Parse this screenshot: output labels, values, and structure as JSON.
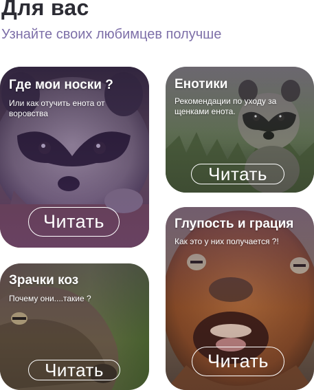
{
  "header": {
    "title": "Для вас",
    "subtitle": "Узнайте своих любимцев получше"
  },
  "cards": [
    {
      "id": "socks",
      "title": "Где мои носки ?",
      "description": "Или как отучить енота от воровства",
      "button_label": "Читать",
      "image": "raccoon-on-fence-photo"
    },
    {
      "id": "raccoons",
      "title": "Енотики",
      "description": "Рекомендации по уходу за щенками енота.",
      "button_label": "Читать",
      "image": "baby-raccoon-in-grass-photo"
    },
    {
      "id": "goat-eyes",
      "title": "Зрачки коз",
      "description": "Почему они....такие ?",
      "button_label": "Читать",
      "image": "goat-head-closeup-photo"
    },
    {
      "id": "goofy",
      "title": "Глупость и грация",
      "description": "Как это у них получается ?!",
      "button_label": "Читать",
      "image": "laughing-brown-goat-photo"
    }
  ],
  "colors": {
    "title": "#2c2c34",
    "subtitle": "#7d6fa8",
    "overlay_purple": "#5a3c82",
    "button_border": "#ffffff"
  }
}
